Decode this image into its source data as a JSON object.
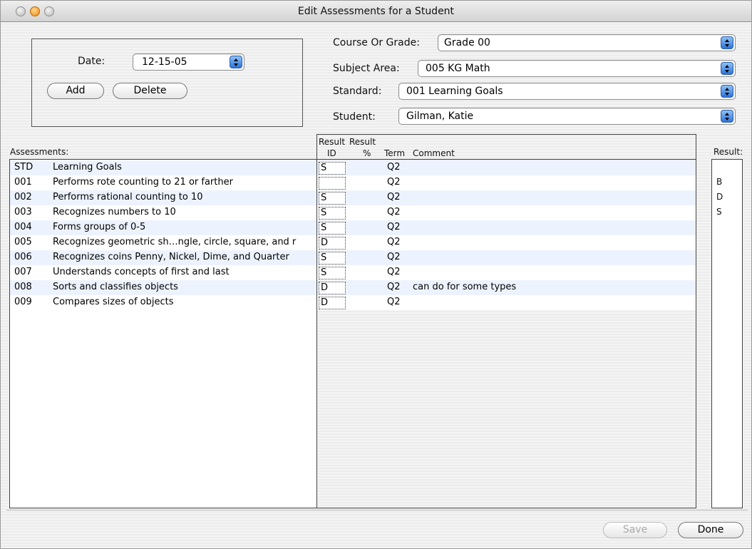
{
  "window": {
    "title": "Edit Assessments for a Student"
  },
  "date_panel": {
    "date_label": "Date:",
    "date_value": "12-15-05",
    "add_label": "Add",
    "delete_label": "Delete"
  },
  "filters": {
    "course_label": "Course Or Grade:",
    "course_value": "Grade 00",
    "subject_label": "Subject Area:",
    "subject_value": "005 KG Math",
    "standard_label": "Standard:",
    "standard_value": "001 Learning Goals",
    "student_label": "Student:",
    "student_value": "Gilman, Katie"
  },
  "assessments": {
    "header": "Assessments:",
    "rows": [
      {
        "code": "STD",
        "desc": "Learning Goals"
      },
      {
        "code": "001",
        "desc": "Performs rote counting to 21 or farther"
      },
      {
        "code": "002",
        "desc": "Performs rational counting to 10"
      },
      {
        "code": "003",
        "desc": "Recognizes numbers to 10"
      },
      {
        "code": "004",
        "desc": "Forms groups of 0-5"
      },
      {
        "code": "005",
        "desc": "Recognizes geometric sh…ngle, circle, square, and r"
      },
      {
        "code": "006",
        "desc": "Recognizes coins Penny, Nickel, Dime, and Quarter"
      },
      {
        "code": "007",
        "desc": "Understands concepts of first and last"
      },
      {
        "code": "008",
        "desc": "Sorts and classifies objects"
      },
      {
        "code": "009",
        "desc": "Compares sizes of objects"
      }
    ]
  },
  "results": {
    "header_result1": "Result",
    "header_result2": "Result",
    "header_id": "ID",
    "header_pct": "%",
    "header_term": "Term",
    "header_comment": "Comment",
    "rows": [
      {
        "id": "S",
        "pct": "",
        "term": "Q2",
        "comment": ""
      },
      {
        "id": "",
        "pct": "",
        "term": "Q2",
        "comment": ""
      },
      {
        "id": "S",
        "pct": "",
        "term": "Q2",
        "comment": ""
      },
      {
        "id": "S",
        "pct": "",
        "term": "Q2",
        "comment": ""
      },
      {
        "id": "S",
        "pct": "",
        "term": "Q2",
        "comment": ""
      },
      {
        "id": "D",
        "pct": "",
        "term": "Q2",
        "comment": ""
      },
      {
        "id": "S",
        "pct": "",
        "term": "Q2",
        "comment": ""
      },
      {
        "id": "S",
        "pct": "",
        "term": "Q2",
        "comment": ""
      },
      {
        "id": "D",
        "pct": "",
        "term": "Q2",
        "comment": "can do for some types"
      },
      {
        "id": "D",
        "pct": "",
        "term": "Q2",
        "comment": ""
      }
    ]
  },
  "result_codes": {
    "header": "Result:",
    "items": [
      "B",
      "D",
      "S"
    ]
  },
  "footer": {
    "save_label": "Save",
    "done_label": "Done"
  }
}
